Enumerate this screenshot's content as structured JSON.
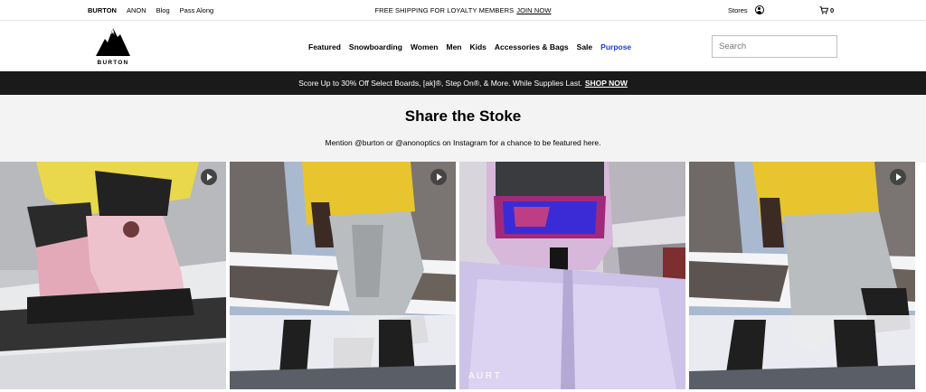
{
  "utility": {
    "links": [
      "BURTON",
      "ANON",
      "Blog",
      "Pass Along"
    ],
    "shipping_text": "FREE SHIPPING FOR LOYALTY MEMBERS",
    "join_label": "JOIN NOW",
    "stores_label": "Stores",
    "cart_count": "0"
  },
  "header": {
    "logo_text": "BURTON",
    "nav": [
      "Featured",
      "Snowboarding",
      "Women",
      "Men",
      "Kids",
      "Accessories & Bags",
      "Sale",
      "Purpose"
    ],
    "search_placeholder": "Search"
  },
  "promo": {
    "text": "Score Up to 30% Off Select Boards, [ak]®, Step On®, & More. While Supplies Last.",
    "link_label": "SHOP NOW"
  },
  "share": {
    "title": "Share the Stoke",
    "subtitle": "Mention @burton or @anonoptics on Instagram for a chance to be featured here."
  },
  "gallery": {
    "tiles": [
      {
        "name": "pink-boots-video",
        "icon": "play-icon"
      },
      {
        "name": "gray-pants-video-1",
        "icon": "play-icon"
      },
      {
        "name": "lavender-jacket-photo",
        "icon": ""
      },
      {
        "name": "gray-pants-video-2",
        "icon": "play-icon"
      }
    ]
  },
  "colors": {
    "promo_bg": "#1a1a1a",
    "purpose_link": "#1a3cd6",
    "share_bg": "#f3f3f3"
  }
}
